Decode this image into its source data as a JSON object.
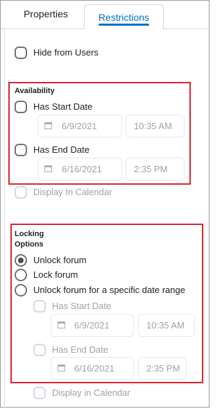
{
  "tabs": {
    "properties": "Properties",
    "restrictions": "Restrictions"
  },
  "hide_from_users": {
    "label": "Hide from Users",
    "checked": false
  },
  "availability": {
    "heading": "Availability",
    "start": {
      "label": "Has Start Date",
      "date": "6/9/2021",
      "time": "10:35 AM"
    },
    "end": {
      "label": "Has End Date",
      "date": "6/16/2021",
      "time": "2:35 PM"
    },
    "display_in_calendar": "Display In Calendar"
  },
  "locking": {
    "heading_line1": "Locking",
    "heading_line2": "Options",
    "options": [
      "Unlock forum",
      "Lock forum",
      "Unlock forum for a specific date range"
    ],
    "selected": "Unlock forum",
    "start": {
      "label": "Has Start Date",
      "date": "6/9/2021",
      "time": "10:35 AM"
    },
    "end": {
      "label": "Has End Date",
      "date": "6/16/2021",
      "time": "2:35 PM"
    },
    "display_in_calendar": "Display in Calendar"
  },
  "colors": {
    "accent": "#006fbf",
    "highlight_box": "#d9232e"
  }
}
